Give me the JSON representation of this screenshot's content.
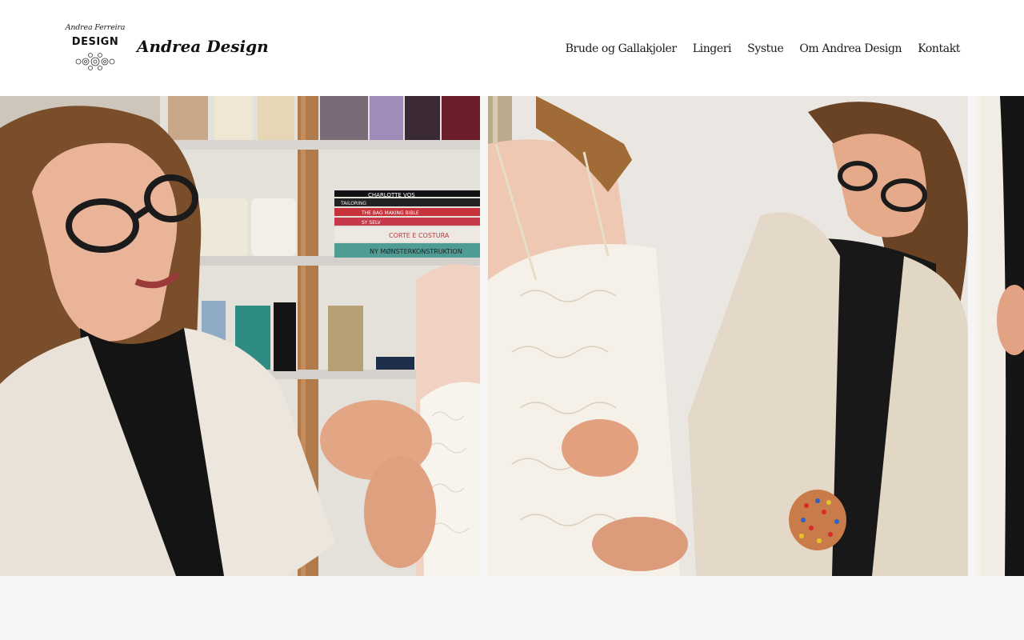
{
  "header": {
    "logo": {
      "script_text": "Andrea Ferreira",
      "word": "DESIGN"
    },
    "brand_name": "Andrea Design"
  },
  "nav": {
    "items": [
      {
        "label": "Brude og Gallakjoler"
      },
      {
        "label": "Lingeri"
      },
      {
        "label": "Systue"
      },
      {
        "label": "Om Andrea Design"
      },
      {
        "label": "Kontakt"
      }
    ]
  },
  "gallery": {
    "slides": [
      {
        "label": "seamstress-fitting-dress-closeup"
      },
      {
        "label": "seamstress-pinning-bridal-gown"
      },
      {
        "label": "partial-next-slide"
      }
    ],
    "books": [
      {
        "title": "CHARLOTTE VOS"
      },
      {
        "title": "TAILORING"
      },
      {
        "title": "THE BAG MAKING BIBLE"
      },
      {
        "title": "SY SELV"
      },
      {
        "title": "CORTE E COSTURA"
      },
      {
        "title": "NY MØNSTERKONSTRUKTION"
      }
    ]
  },
  "colors": {
    "header_bg": "#ffffff",
    "page_bg": "#f5f5f5",
    "text": "#1a1a1a"
  }
}
